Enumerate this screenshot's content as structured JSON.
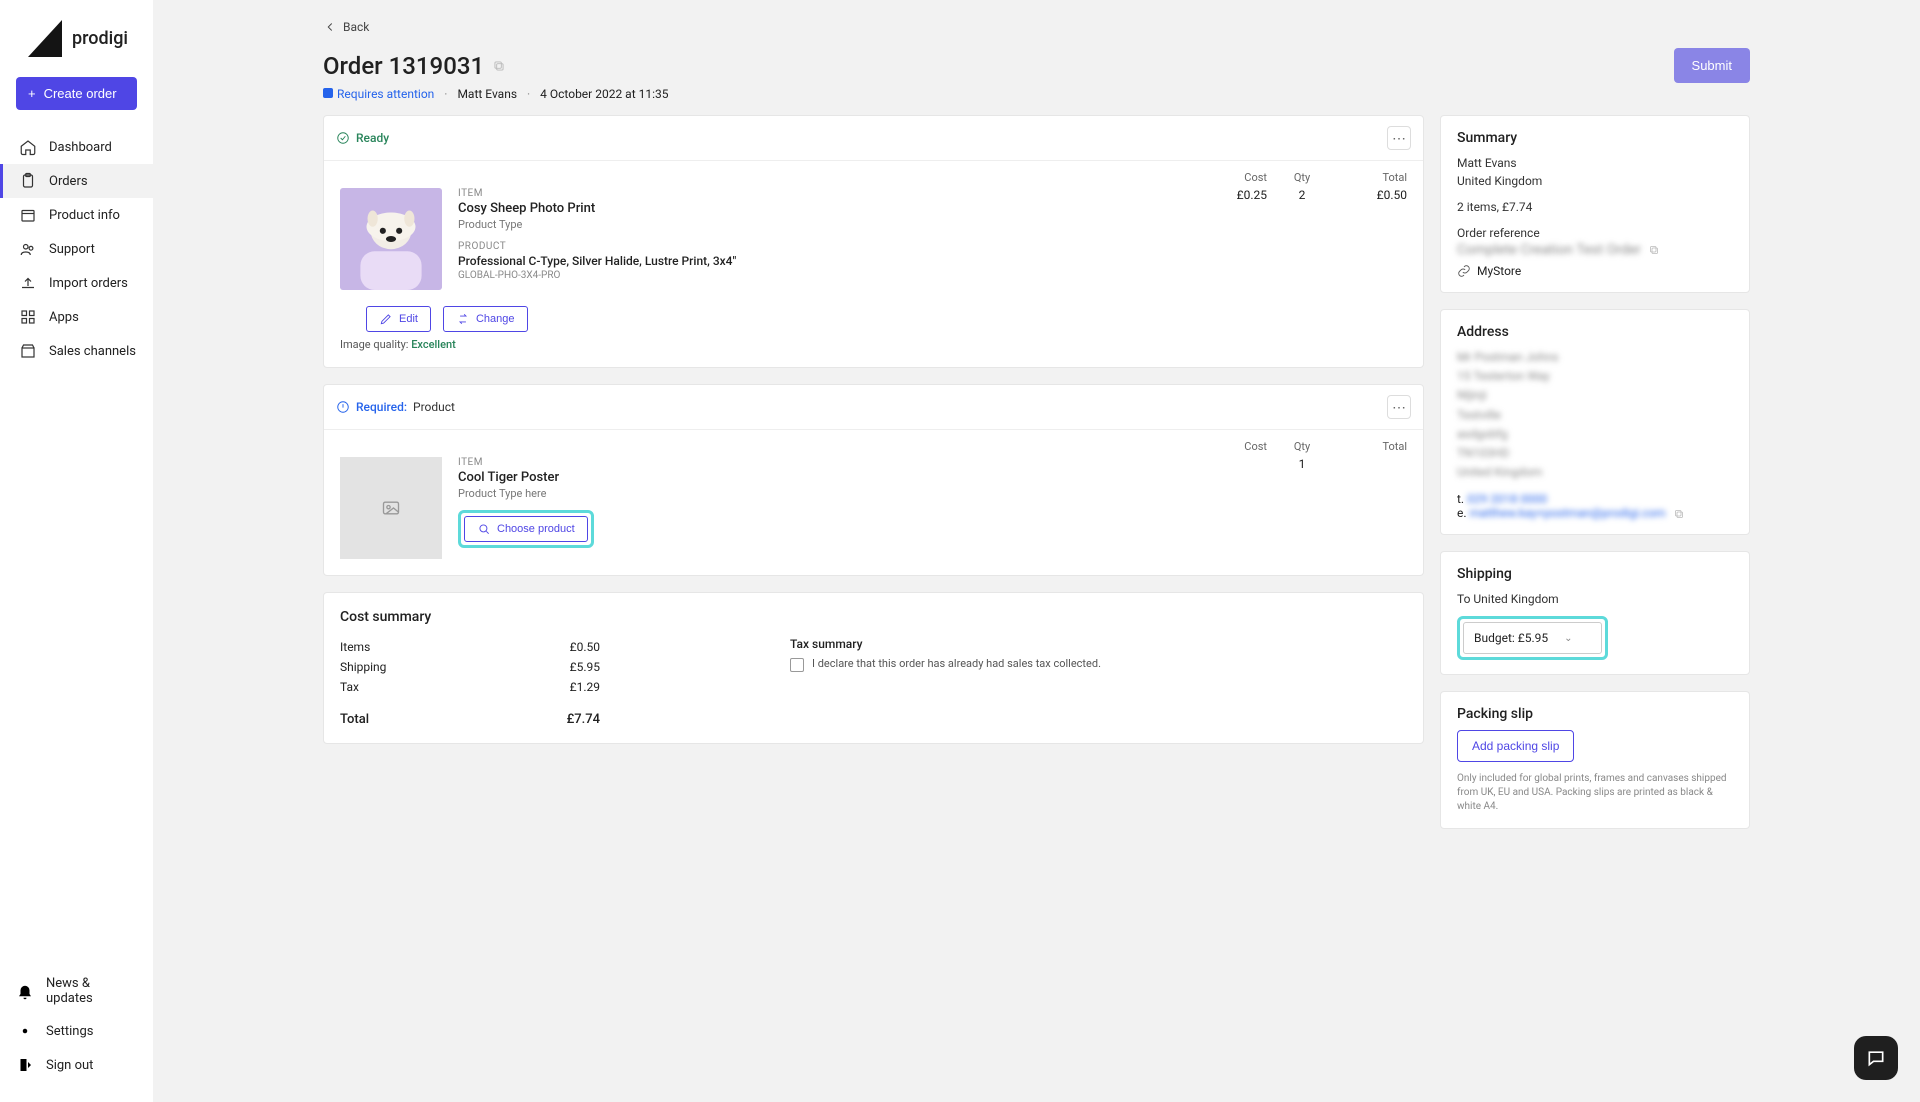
{
  "brand": {
    "name": "prodigi"
  },
  "sidebar": {
    "create_label": "Create order",
    "items": [
      {
        "label": "Dashboard"
      },
      {
        "label": "Orders"
      },
      {
        "label": "Product info"
      },
      {
        "label": "Support"
      },
      {
        "label": "Import orders"
      },
      {
        "label": "Apps"
      },
      {
        "label": "Sales channels"
      }
    ],
    "bottom": [
      {
        "label": "News & updates"
      },
      {
        "label": "Settings"
      },
      {
        "label": "Sign out"
      }
    ]
  },
  "header": {
    "back_label": "Back",
    "title": "Order 1319031",
    "status": "Requires attention",
    "customer": "Matt Evans",
    "datetime": "4 October 2022 at 11:35",
    "submit_label": "Submit"
  },
  "item1": {
    "card_status": "Ready",
    "cols": {
      "cost": "Cost",
      "qty": "Qty",
      "total": "Total"
    },
    "item_label": "ITEM",
    "name": "Cosy Sheep Photo Print",
    "subtype": "Product Type",
    "product_label": "PRODUCT",
    "product": "Professional C-Type, Silver Halide, Lustre Print, 3x4\"",
    "sku": "GLOBAL-PHO-3X4-PRO",
    "cost": "£0.25",
    "qty": "2",
    "total": "£0.50",
    "edit_label": "Edit",
    "change_label": "Change",
    "quality_prefix": "Image quality: ",
    "quality_value": "Excellent"
  },
  "item2": {
    "required_prefix": "Required:",
    "required_target": " Product",
    "cols": {
      "cost": "Cost",
      "qty": "Qty",
      "total": "Total"
    },
    "item_label": "ITEM",
    "name": "Cool Tiger Poster",
    "subtype": "Product Type here",
    "qty": "1",
    "choose_label": "Choose product"
  },
  "cost": {
    "title": "Cost summary",
    "rows": [
      {
        "label": "Items",
        "value": "£0.50"
      },
      {
        "label": "Shipping",
        "value": "£5.95"
      },
      {
        "label": "Tax",
        "value": "£1.29"
      }
    ],
    "total_label": "Total",
    "total_value": "£7.74",
    "tax_title": "Tax summary",
    "tax_declare": "I declare that this order has already had sales tax collected."
  },
  "summary": {
    "title": "Summary",
    "name": "Matt Evans",
    "country": "United Kingdom",
    "items_line": "2 items, £7.74",
    "ref_label": "Order reference",
    "ref_value": "Complete Creation Test Order",
    "store": "MyStore"
  },
  "address": {
    "title": "Address",
    "lines": [
      "Mr Postman Johns",
      "15 Testerton Way",
      "Nljinji",
      "Testville",
      "asdgobfg",
      "TN103HD",
      "United Kingdom"
    ],
    "t_label": "t. ",
    "t_value": "029 2018 0000",
    "e_label": "e. ",
    "e_value": "matthew.kay+postman@prodigi.com"
  },
  "shipping": {
    "title": "Shipping",
    "to_line": "To United Kingdom",
    "option": "Budget: £5.95"
  },
  "packing": {
    "title": "Packing slip",
    "btn": "Add packing slip",
    "note": "Only included for global prints, frames and canvases shipped from UK, EU and USA. Packing slips are printed as black & white A4."
  }
}
